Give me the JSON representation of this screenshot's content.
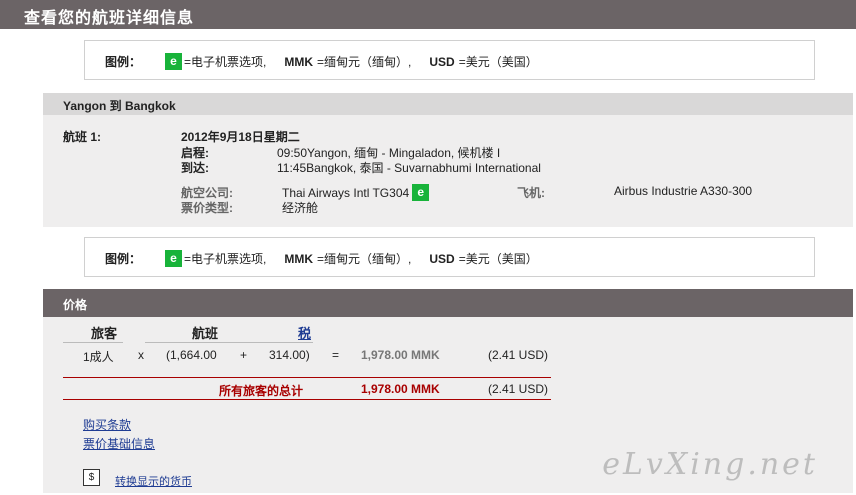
{
  "header": {
    "title": "查看您的航班详细信息"
  },
  "legend": {
    "label": "图例：",
    "e_badge": "e",
    "e_text": "=电子机票选项,",
    "mmk_code": "MMK",
    "mmk_text": "=缅甸元（缅甸）,",
    "usd_code": "USD",
    "usd_text": "=美元（美国）"
  },
  "route": {
    "title": "Yangon 到 Bangkok"
  },
  "flight": {
    "label": "航班 1:",
    "date": "2012年9月18日星期二",
    "depart_label": "启程:",
    "depart_value": "09:50Yangon, 缅甸 - Mingaladon, 候机楼 I",
    "arrive_label": "到达:",
    "arrive_value": "11:45Bangkok, 泰国 - Suvarnabhumi International",
    "airline_label": "航空公司:",
    "airline_value": "Thai Airways Intl TG304",
    "aircraft_label": "飞机:",
    "aircraft_value": "Airbus Industrie A330-300",
    "fare_type_label": "票价类型:",
    "fare_type_value": "经济舱"
  },
  "price": {
    "title": "价格",
    "col_passenger": "旅客",
    "col_flight": "航班",
    "col_tax": "税",
    "row": {
      "passenger": "1成人",
      "times": "x",
      "fare": "(1,664.00",
      "plus": "+",
      "tax": "314.00)",
      "equals": "=",
      "total_mmk": "1,978.00 MMK",
      "total_usd": "(2.41 USD)"
    },
    "grand_label": "所有旅客的总计",
    "grand_mmk": "1,978.00 MMK",
    "grand_usd": "(2.41 USD)",
    "link_terms": "购买条款",
    "link_fare_basis": "票价基础信息",
    "currency_icon": "currency-exchange-icon",
    "link_currency": "转换显示的货币"
  },
  "watermark": "eLvXing.net"
}
